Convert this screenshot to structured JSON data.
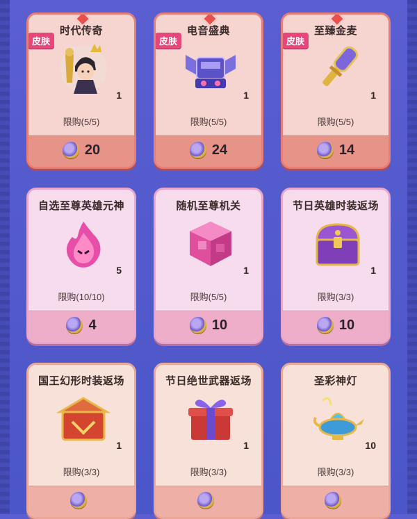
{
  "colors": {
    "background": "#5a5ed0",
    "skin_badge": "#e6467a",
    "red_card_border": "#e77e78",
    "pink_card_border": "#e9a7cd"
  },
  "badge_label": "皮肤",
  "currency_icon": "crystal-coin-icon",
  "items": [
    {
      "title": "时代传奇",
      "skin": true,
      "qty": "1",
      "limit": "限购(5/5)",
      "price": "20",
      "icon": "hero-skin-portrait-icon"
    },
    {
      "title": "电音盛典",
      "skin": true,
      "qty": "1",
      "limit": "限购(5/5)",
      "price": "24",
      "icon": "dj-console-icon"
    },
    {
      "title": "至臻金麦",
      "skin": true,
      "qty": "1",
      "limit": "限购(5/5)",
      "price": "14",
      "icon": "golden-microphone-icon"
    },
    {
      "title": "自选至尊英雄元神",
      "skin": false,
      "qty": "5",
      "limit": "限购(10/10)",
      "price": "4",
      "icon": "hero-spirit-flame-icon"
    },
    {
      "title": "随机至尊机关",
      "skin": false,
      "qty": "1",
      "limit": "限购(5/5)",
      "price": "10",
      "icon": "mechanism-cube-icon"
    },
    {
      "title": "节日英雄时装返场",
      "skin": false,
      "qty": "1",
      "limit": "限购(3/3)",
      "price": "10",
      "icon": "treasure-chest-icon"
    },
    {
      "title": "国王幻形时装返场",
      "skin": false,
      "qty": "1",
      "limit": "限购(3/3)",
      "price": "",
      "icon": "king-chest-icon"
    },
    {
      "title": "节日绝世武器返场",
      "skin": false,
      "qty": "1",
      "limit": "限购(3/3)",
      "price": "",
      "icon": "gift-box-icon"
    },
    {
      "title": "圣彩神灯",
      "skin": false,
      "qty": "10",
      "limit": "限购(3/3)",
      "price": "",
      "icon": "magic-lamp-icon"
    }
  ]
}
